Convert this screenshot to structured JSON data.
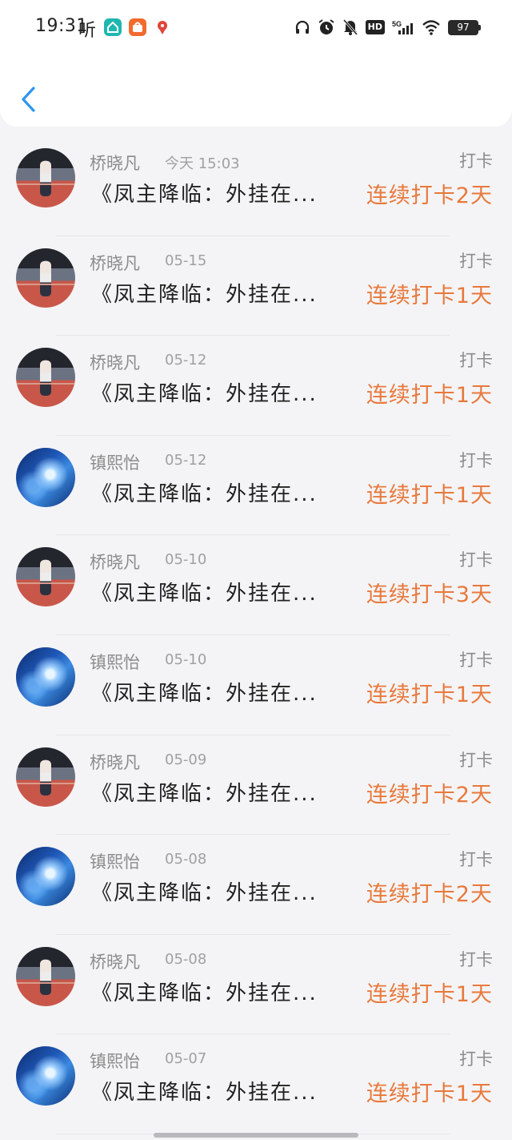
{
  "status_bar": {
    "time": "19:31",
    "carrier": "听",
    "network": "5G",
    "hd": "HD",
    "battery": "97",
    "app_badges": [
      {
        "icon": "home-app-icon",
        "color": "#1fb7b0"
      },
      {
        "icon": "shopping-app-icon",
        "color": "#f26a2d"
      },
      {
        "icon": "map-pin-app-icon",
        "color": "#e0453a"
      }
    ],
    "right_icons": [
      "headphones-icon",
      "alarm-icon",
      "mute-bell-icon"
    ]
  },
  "header": {
    "back_icon": "chevron-left-icon",
    "accent": "#2f95f0"
  },
  "colors": {
    "streak": "#e8793c"
  },
  "checkins": [
    {
      "avatar": "person",
      "name": "桥晓凡",
      "date": "今天 15:03",
      "kind": "打卡",
      "title": "《凤主降临：外挂在...",
      "streak": "连续打卡2天"
    },
    {
      "avatar": "person",
      "name": "桥晓凡",
      "date": "05-15",
      "kind": "打卡",
      "title": "《凤主降临：外挂在...",
      "streak": "连续打卡1天"
    },
    {
      "avatar": "person",
      "name": "桥晓凡",
      "date": "05-12",
      "kind": "打卡",
      "title": "《凤主降临：外挂在...",
      "streak": "连续打卡1天"
    },
    {
      "avatar": "space",
      "name": "镇熙怡",
      "date": "05-12",
      "kind": "打卡",
      "title": "《凤主降临：外挂在...",
      "streak": "连续打卡1天"
    },
    {
      "avatar": "person",
      "name": "桥晓凡",
      "date": "05-10",
      "kind": "打卡",
      "title": "《凤主降临：外挂在...",
      "streak": "连续打卡3天"
    },
    {
      "avatar": "space",
      "name": "镇熙怡",
      "date": "05-10",
      "kind": "打卡",
      "title": "《凤主降临：外挂在...",
      "streak": "连续打卡1天"
    },
    {
      "avatar": "person",
      "name": "桥晓凡",
      "date": "05-09",
      "kind": "打卡",
      "title": "《凤主降临：外挂在...",
      "streak": "连续打卡2天"
    },
    {
      "avatar": "space",
      "name": "镇熙怡",
      "date": "05-08",
      "kind": "打卡",
      "title": "《凤主降临：外挂在...",
      "streak": "连续打卡2天"
    },
    {
      "avatar": "person",
      "name": "桥晓凡",
      "date": "05-08",
      "kind": "打卡",
      "title": "《凤主降临：外挂在...",
      "streak": "连续打卡1天"
    },
    {
      "avatar": "space",
      "name": "镇熙怡",
      "date": "05-07",
      "kind": "打卡",
      "title": "《凤主降临：外挂在...",
      "streak": "连续打卡1天"
    }
  ]
}
